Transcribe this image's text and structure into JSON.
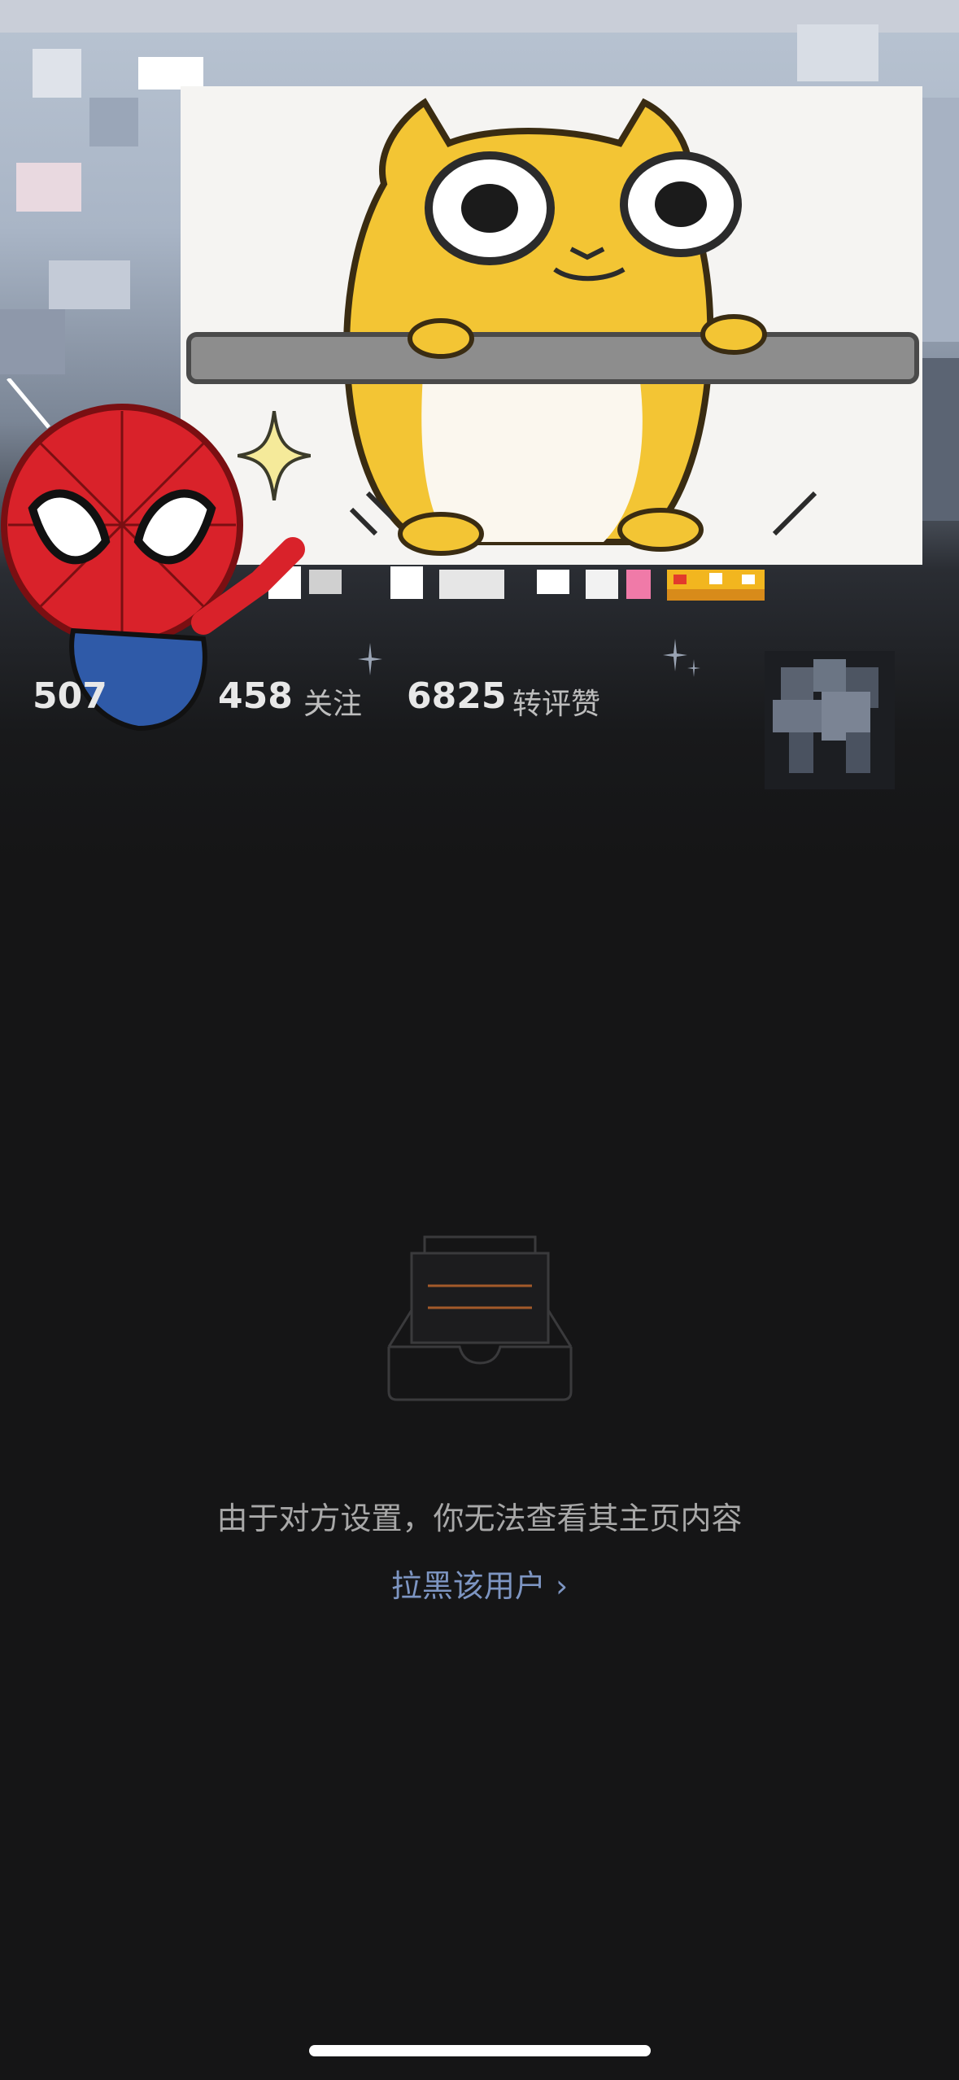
{
  "stats": {
    "followers_partial": "507",
    "following_count": "458",
    "following_label": "关注",
    "likes_count": "6825",
    "likes_label": "转评赞"
  },
  "empty_state": {
    "message": "由于对方设置，你无法查看其主页内容",
    "action_label": "拉黑该用户 ›"
  },
  "icons": {
    "empty": "inbox-tray-icon",
    "stickers": [
      "cat-sticker",
      "spiderman-sticker"
    ]
  },
  "colors": {
    "background": "#151516",
    "link": "#7d95c2",
    "text_secondary": "#a8a8a8"
  }
}
